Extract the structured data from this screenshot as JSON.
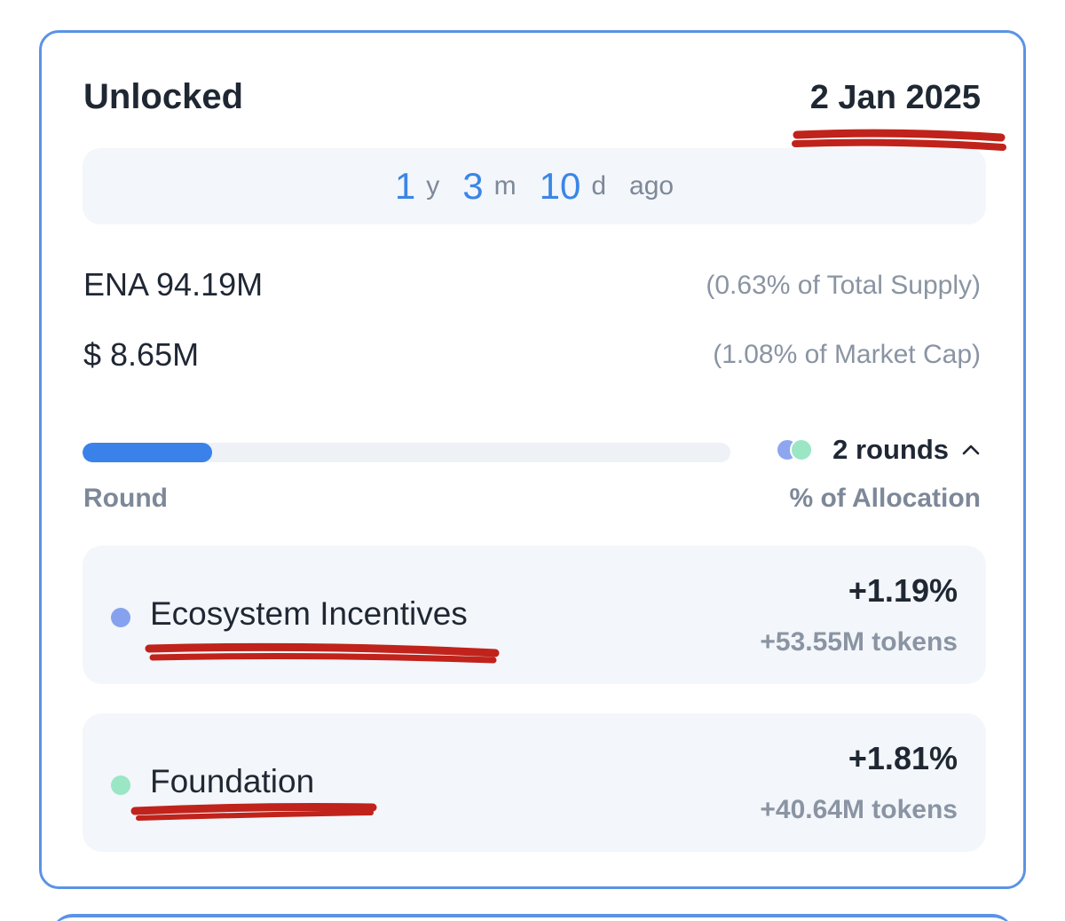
{
  "header": {
    "title": "Unlocked",
    "date": "2 Jan 2025"
  },
  "ago": {
    "years": "1",
    "years_unit": "y",
    "months": "3",
    "months_unit": "m",
    "days": "10",
    "days_unit": "d",
    "suffix": "ago"
  },
  "summary": {
    "token_amount": "ENA 94.19M",
    "token_pct": "(0.63% of Total Supply)",
    "usd_amount": "$ 8.65M",
    "usd_pct": "(1.08% of Market Cap)"
  },
  "progress": {
    "fraction": 0.2,
    "rounds_label": "2 rounds"
  },
  "columns": {
    "left": "Round",
    "right": "% of Allocation"
  },
  "rounds": [
    {
      "name": "Ecosystem Incentives",
      "percent": "+1.19%",
      "tokens": "+53.55M tokens",
      "color": "#86a2ee"
    },
    {
      "name": "Foundation",
      "percent": "+1.81%",
      "tokens": "+40.64M tokens",
      "color": "#9ae6c5"
    }
  ],
  "colors": {
    "accent": "#3a86e8",
    "card_border": "#5b93e6",
    "annotation_red": "#c0231b"
  },
  "icons": {
    "rounds_toggle": "chevron-up-icon",
    "rounds_dots": "stacked-dots-icon"
  }
}
